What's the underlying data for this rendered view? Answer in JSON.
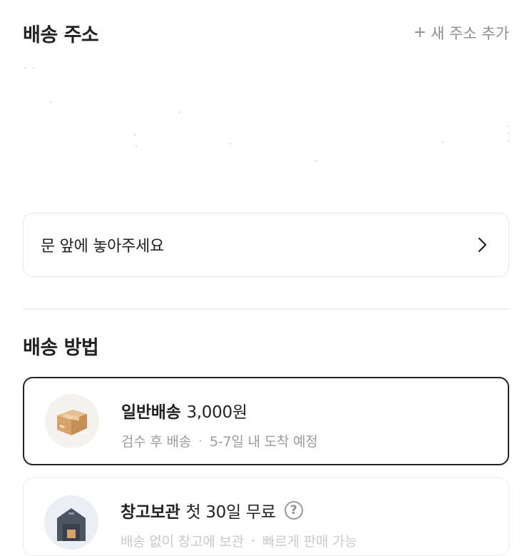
{
  "address_section": {
    "title": "배송 주소",
    "add_link": "새 주소 추가",
    "add_icon": "+",
    "memo": "문 앞에 놓아주세요"
  },
  "method_section": {
    "title": "배송 방법",
    "options": [
      {
        "name": "일반배송",
        "price": "3,000원",
        "desc_a": "검수 후 배송",
        "separator": "·",
        "desc_b": "5-7일 내 도착 예정",
        "icon": "box-icon",
        "selected": true
      },
      {
        "name": "창고보관",
        "price": "첫 30일 무료",
        "help": "?",
        "desc_a": "배송 없이 창고에 보관",
        "separator": "·",
        "desc_b": "빠르게 판매 가능",
        "icon": "warehouse-icon",
        "selected": false
      }
    ]
  }
}
